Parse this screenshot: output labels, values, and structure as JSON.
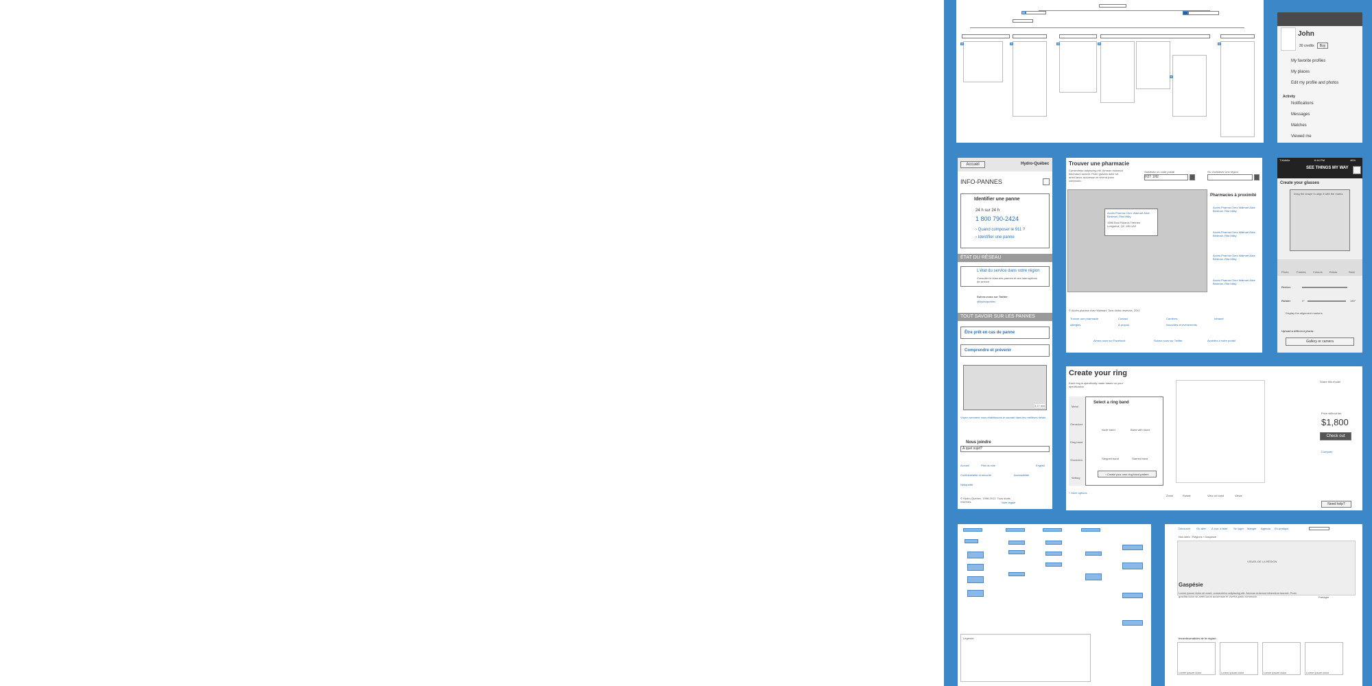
{
  "colors": {
    "panel_blue": "#3c87c8",
    "accent": "#2f7ed8",
    "dark_header": "#4a4a4a"
  },
  "profile": {
    "name": "John",
    "credits": "30 credits",
    "buy": "Buy",
    "menu": [
      "My favorite profiles",
      "My places",
      "Edit my profile and photos"
    ],
    "activity_heading": "Activity",
    "activity": [
      "Notifications",
      "Messages",
      "Matches",
      "Viewed me"
    ]
  },
  "hydro": {
    "back": "Accueil",
    "logo": "Hydro-Québec",
    "title": "INFO-PANNES",
    "identify_title": "Identifier une panne",
    "hours": "24 h sur 24 h",
    "phone": "1 800 790-2424",
    "link1": "› Quand composer le 911 ?",
    "link2": "› Identifier une panne",
    "section_state": "ÉTAT DU RÉSEAU",
    "state_item_title": "L'état du service dans votre région",
    "state_item_desc": "Consulter le bilan des pannes et des interruptions de service",
    "twitter": "Suivez-nous sur Twitter",
    "twitter_handle": "@hydroquebec",
    "section_learn": "TOUT SAVOIR SUR LES PANNES",
    "learn1": "Être prêt en cas de panne",
    "learn2": "Comprendre et prévenir",
    "video_time": "3:17 min",
    "video_caption": "Voyez comment nous rétablissons le courant dans les meilleurs délais.",
    "contact_heading": "Nous joindre",
    "contact_select": "À quel sujet?",
    "footer_links": [
      "Accueil",
      "Plan du site",
      "English",
      "Confidentialité et sécurité",
      "Accessibilité",
      "Nétiquette"
    ],
    "copyright": "© Hydro-Québec, 1996-2012. Tous droits réservés.",
    "legal": "Note légale"
  },
  "pharmacy": {
    "title": "Trouver une pharmacie",
    "desc": "Consectetur adipiscing elit. Aenean euismod bibendum laoreet. Proin gravida dolor sit amet lacus accumsan et viverra justo commodo.",
    "field1_label": "Saisissez un code postal",
    "field1_value": "H2T 1H2",
    "field2_label": "Ou choisissez une région",
    "results_title": "Pharmacies à proximité",
    "results": [
      "Accès Pharma Chez Walmart Alice Bédman, Rita Milky",
      "Accès Pharma Chez Walmart Alice Bédman, Rita Milky",
      "Accès Pharma Chez Walmart Alice Bédman, Rita Milky",
      "Accès Pharma Chez Walmart Alice Bédman, Rita Milky"
    ],
    "popup_title": "Accès Pharma Chez Walmart Alice Bédman, Rita Milky",
    "popup_addr": "1986 Boul Roland-Therrien Longueuil, QC J4N 1A3",
    "copyright": "© Accès pharma chez Walmart. Tous droits réservés. 2011",
    "footer_links": [
      "Trouver une pharmacie",
      "Contact",
      "Carrières",
      "Intranet",
      "Allergies",
      "À propos",
      "Nouvelles et événements"
    ],
    "social": [
      "Aimez-nous sur Facebook",
      "Suivez-nous sur Twitter",
      "Accédez à notre portail"
    ]
  },
  "glasses": {
    "status_left": "T-Mobile",
    "status_time": "6:44 PM",
    "status_right": "46%",
    "logo": "SEE THINGS MY WAY",
    "title": "Create your glasses",
    "hint": "Drag the shape to align it with the marks",
    "tabs": [
      "Photo",
      "Frames",
      "Colours",
      "Extras",
      "Save"
    ],
    "resize": "Resize:",
    "rotate": "Rotate:",
    "rot_min": "0°",
    "rot_max": "180°",
    "markers": "Display the alignment markers",
    "upload": "Upload a different photo:",
    "gallery": "Gallery or camera"
  },
  "ring": {
    "title": "Create your ring",
    "subtitle": "Each ring is specifically made based on your specification",
    "steps": [
      "Metal",
      "Gemstone",
      "Ring band",
      "Shoulders",
      "Setting"
    ],
    "band_heading": "Select a ring band",
    "bands": [
      "Nude band",
      "Band with stone",
      "Stepped band",
      "Starred band"
    ],
    "create_own": "› Create your own ring band pattern",
    "more": "+ More options",
    "share": "Share this model",
    "price_label": "Price without tax",
    "price": "$1,800",
    "checkout": "Check out",
    "compare": "Compare",
    "views": [
      "Zoom",
      "Rotate",
      "View on hand",
      "Views"
    ],
    "help": "Need help?"
  },
  "gaspesie": {
    "nav": [
      "Découvrir",
      "Où aller",
      "À voir, à faire",
      "Se loger",
      "Manger",
      "Agenda",
      "En pratique"
    ],
    "breadcrumb": "Nos sites › Régions › Gaspésie",
    "hero": "VISUEL DE LA RÉGION",
    "title": "Gaspésie",
    "intro": "Lorem ipsum dolor sit amet, consectetur adipiscing elit. Aenean euismod bibendum laoreet. Proin gravida dolor sit amet lacus accumsan et viverra justo commodo.",
    "partager": "Partager",
    "section": "Incontournables de la région",
    "cards": [
      "Lorem ipsum dolor",
      "Lorem ipsum dolor",
      "Lorem ipsum dolor",
      "Lorem ipsum dolor"
    ]
  },
  "legend": {
    "title": "Légende"
  }
}
